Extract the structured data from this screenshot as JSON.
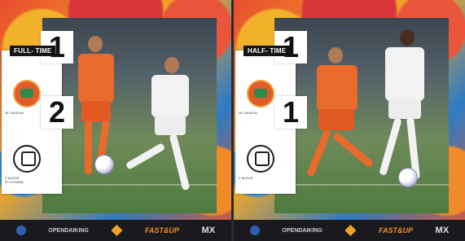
{
  "panels": [
    {
      "status": "FULL- TIME",
      "home": {
        "score": "1",
        "scorer": "36' TAUDON"
      },
      "away": {
        "score": "2",
        "scorers": [
          "2' ALDOS",
          "67' EVGENE"
        ]
      }
    },
    {
      "status": "HALF- TIME",
      "home": {
        "score": "1",
        "scorer": "36' TAUDON"
      },
      "away": {
        "score": "1",
        "scorers": [
          "2' ALDOS"
        ]
      }
    }
  ],
  "sponsors": {
    "brand_a": "OPENDAIKING",
    "brand_b": "FAST&UP",
    "brand_c": "MX"
  },
  "colors": {
    "home_kit": "#e86b2c",
    "away_kit": "#f2f2f2",
    "score_card": "#ffffff",
    "status_tag": "#141414"
  },
  "icons": [
    "home-club-crest-icon",
    "away-club-crest-icon",
    "football-icon",
    "sponsor-logo-icon"
  ]
}
